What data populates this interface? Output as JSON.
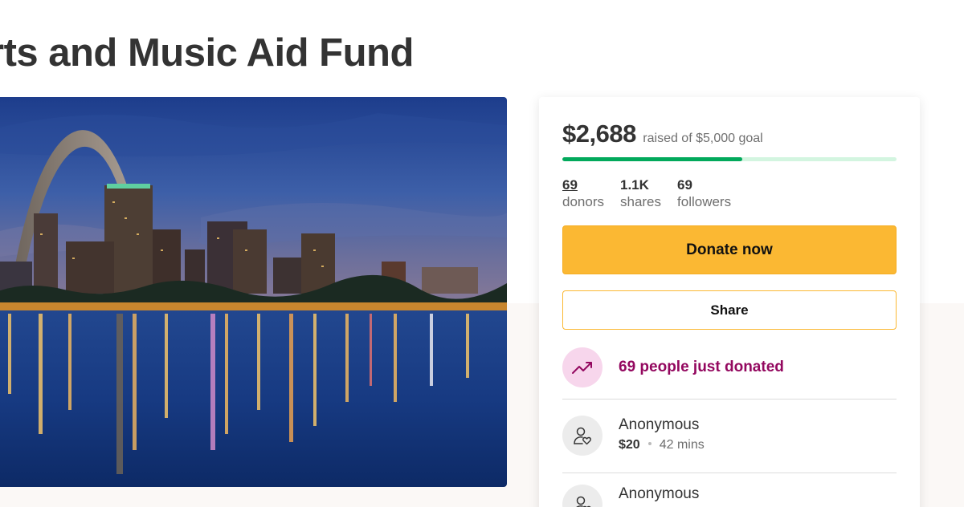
{
  "campaign": {
    "title": "rts and Music Aid Fund"
  },
  "hero": {
    "alt": "St. Louis skyline with Gateway Arch at dusk reflected in the river"
  },
  "fundraiser": {
    "raised": "$2,688",
    "goal_text": "raised of $5,000 goal",
    "progress_fraction": 0.5376,
    "stats": [
      {
        "value": "69",
        "label": "donors"
      },
      {
        "value": "1.1K",
        "label": "shares"
      },
      {
        "value": "69",
        "label": "followers"
      }
    ],
    "donate_label": "Donate now",
    "share_label": "Share",
    "trend_text": "69 people just donated",
    "donations": [
      {
        "name": "Anonymous",
        "amount": "$20",
        "time": "42 mins"
      },
      {
        "name": "Anonymous"
      }
    ]
  },
  "colors": {
    "progress_fill": "#02a95c",
    "progress_track": "#d3f5e0",
    "donate_button": "#fbb833",
    "trend_text": "#93085f",
    "trend_circle": "#f7d6ec"
  }
}
